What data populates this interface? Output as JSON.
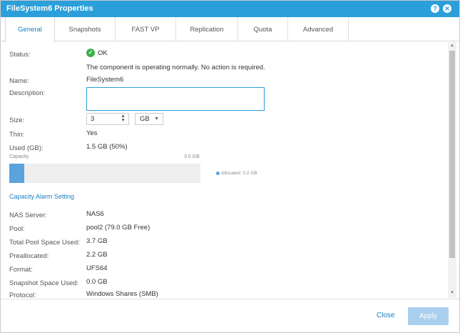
{
  "window": {
    "title": "FileSystem6 Properties",
    "help_glyph": "?",
    "close_glyph": "✕"
  },
  "tabs": [
    {
      "label": "General",
      "active": true
    },
    {
      "label": "Snapshots"
    },
    {
      "label": "FAST VP"
    },
    {
      "label": "Replication"
    },
    {
      "label": "Quota"
    },
    {
      "label": "Advanced"
    }
  ],
  "general": {
    "status_label": "Status:",
    "status_value": "OK",
    "status_message": "The component is operating normally. No action is required.",
    "name_label": "Name:",
    "name_value": "FileSystem6",
    "description_label": "Description:",
    "description_value": "",
    "size_label": "Size:",
    "size_value": "3",
    "size_unit": "GB",
    "thin_label": "Thin:",
    "thin_value": "Yes",
    "used_label": "Used (GB):",
    "used_value": "1.5 GB (50%)",
    "capacity_label": "Capacity",
    "capacity_total": "3.0 GB",
    "capacity_allocated_fraction": 0.08,
    "allocated_legend": "Allocated: 0.2 GB",
    "alarm_link": "Capacity Alarm Setting",
    "nas_server_label": "NAS Server:",
    "nas_server_value": "NAS6",
    "pool_label": "Pool:",
    "pool_value": "pool2 (79.0 GB Free)",
    "total_pool_label": "Total Pool Space Used:",
    "total_pool_value": "3.7 GB",
    "preallocated_label": "Preallocated:",
    "preallocated_value": "2.2 GB",
    "format_label": "Format:",
    "format_value": "UFS64",
    "snapshot_space_label": "Snapshot Space Used:",
    "snapshot_space_value": "0.0 GB",
    "protocol_label": "Protocol:",
    "protocol_value": "Windows Shares (SMB)"
  },
  "footer": {
    "close_label": "Close",
    "apply_label": "Apply"
  },
  "colors": {
    "accent": "#2b9fd9",
    "ok": "#3cb04b",
    "link": "#1a7fc1",
    "fill": "#5aa3dd"
  }
}
